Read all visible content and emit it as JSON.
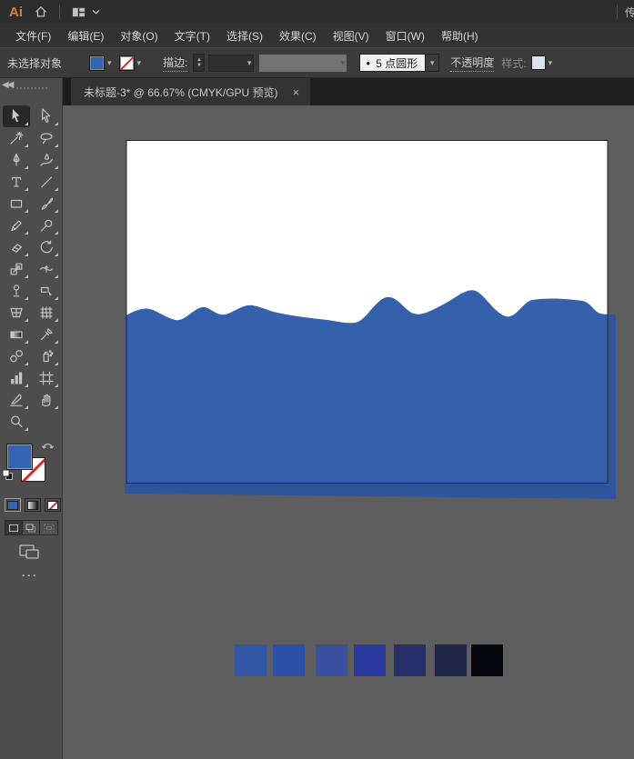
{
  "topbar": {
    "logo": "Ai",
    "right_partial": "传"
  },
  "menubar": {
    "items": [
      {
        "label": "文件(F)"
      },
      {
        "label": "编辑(E)"
      },
      {
        "label": "对象(O)"
      },
      {
        "label": "文字(T)"
      },
      {
        "label": "选择(S)"
      },
      {
        "label": "效果(C)"
      },
      {
        "label": "视图(V)"
      },
      {
        "label": "窗口(W)"
      },
      {
        "label": "帮助(H)"
      }
    ]
  },
  "controlbar": {
    "no_selection": "未选择对象",
    "stroke_label": "描边:",
    "brush_dot": "●",
    "brush_name": "5 点圆形",
    "opacity_label": "不透明度",
    "style_label": "样式:"
  },
  "tabbar": {
    "title": "未标题-3* @ 66.67%  (CMYK/GPU 预览)",
    "close": "×"
  },
  "toolbar": {
    "tools": [
      {
        "name": "selection-tool",
        "selected": true
      },
      {
        "name": "direct-selection-tool"
      },
      {
        "name": "magic-wand-tool"
      },
      {
        "name": "lasso-tool"
      },
      {
        "name": "pen-tool"
      },
      {
        "name": "curvature-tool"
      },
      {
        "name": "type-tool"
      },
      {
        "name": "line-segment-tool"
      },
      {
        "name": "rectangle-tool"
      },
      {
        "name": "paintbrush-tool"
      },
      {
        "name": "pencil-tool"
      },
      {
        "name": "shaper-tool"
      },
      {
        "name": "eraser-tool"
      },
      {
        "name": "rotate-tool"
      },
      {
        "name": "scale-tool"
      },
      {
        "name": "width-tool"
      },
      {
        "name": "puppet-warp-tool"
      },
      {
        "name": "shape-builder-tool"
      },
      {
        "name": "perspective-grid-tool"
      },
      {
        "name": "mesh-tool"
      },
      {
        "name": "gradient-tool"
      },
      {
        "name": "eyedropper-tool"
      },
      {
        "name": "blend-tool"
      },
      {
        "name": "symbol-sprayer-tool"
      },
      {
        "name": "column-graph-tool"
      },
      {
        "name": "artboard-tool"
      },
      {
        "name": "slice-tool"
      },
      {
        "name": "hand-tool"
      },
      {
        "name": "zoom-tool"
      }
    ],
    "more_label": "···"
  },
  "colors": {
    "fill": "#3464B4",
    "wave": "#3560AC",
    "wave_overflow_shade": "rgba(0,0,0,0.10)",
    "artboard": "#FFFFFF",
    "pasteboard": "#5E5E5E",
    "stroke_none_slash": "#D22C2C"
  },
  "swatches": {
    "colors": [
      "#3056A5",
      "#2B51A8",
      "#3A4FA0",
      "#2B3A9E",
      "#272F6B",
      "#1F2547",
      "#07070F"
    ]
  }
}
